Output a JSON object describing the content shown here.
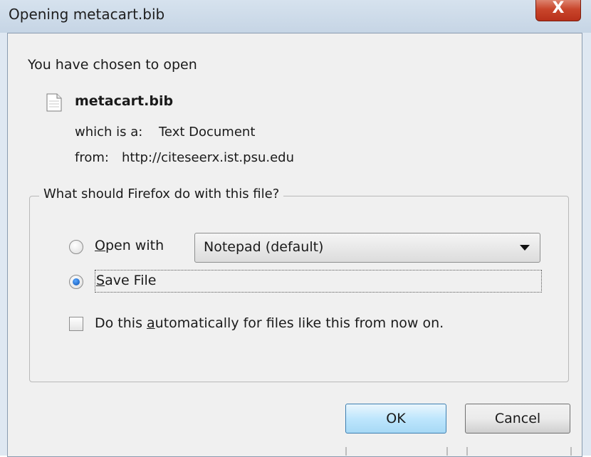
{
  "window": {
    "title": "Opening metacart.bib",
    "close_glyph": "X"
  },
  "intro": "You have chosen to open",
  "file": {
    "name": "metacart.bib",
    "icon": "text-file-icon",
    "type_label": "which is a:",
    "type_value": "Text Document",
    "from_label": "from:",
    "from_value": "http://citeseerx.ist.psu.edu"
  },
  "group": {
    "legend": "What should Firefox do with this file?",
    "open_with": {
      "label_prefix": "",
      "label_underlined": "O",
      "label_rest": "pen with",
      "selected": false,
      "app": "Notepad (default)"
    },
    "save_file": {
      "label_underlined": "S",
      "label_rest": "ave File",
      "selected": true
    },
    "auto": {
      "label_prefix": "Do this ",
      "label_underlined": "a",
      "label_rest": "utomatically for files like this from now on.",
      "checked": false
    }
  },
  "buttons": {
    "ok": "OK",
    "cancel": "Cancel"
  },
  "colors": {
    "accent": "#3c7fb1",
    "close": "#c9462c"
  }
}
